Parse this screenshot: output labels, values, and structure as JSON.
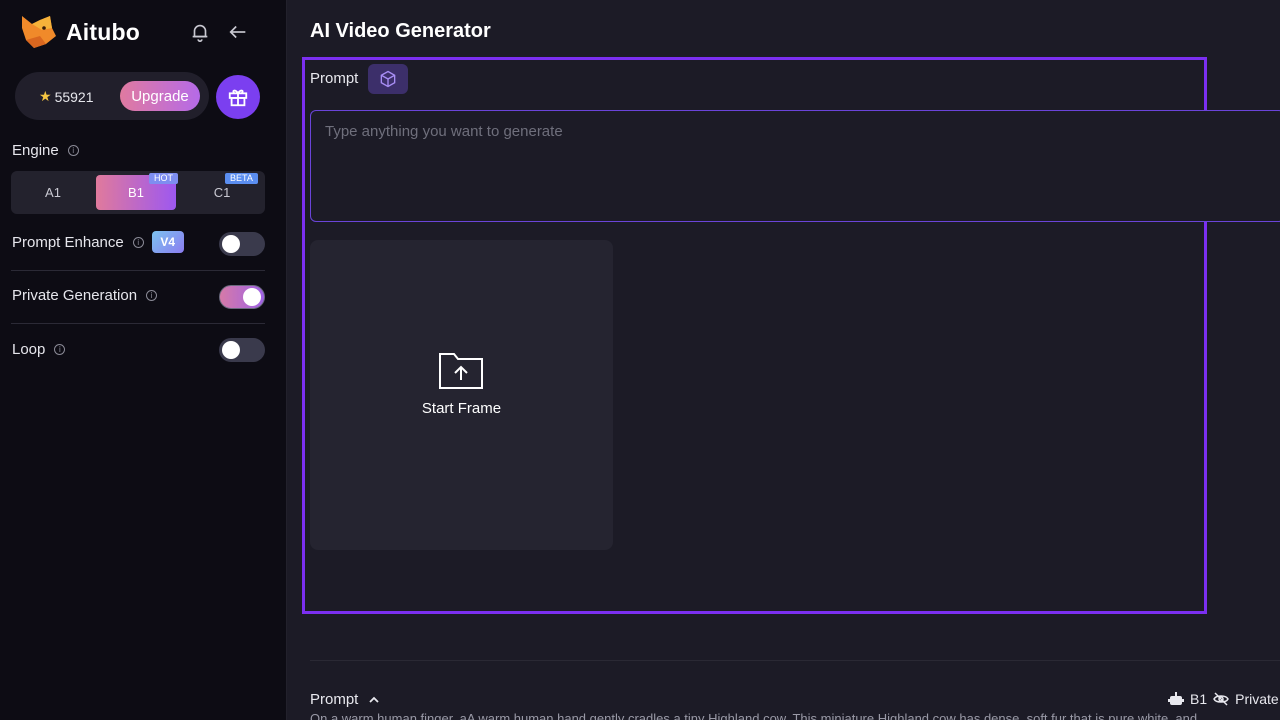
{
  "brand": {
    "name": "Aitubo"
  },
  "credits": {
    "amount": "55921",
    "upgrade_label": "Upgrade"
  },
  "engine": {
    "label": "Engine",
    "options": [
      {
        "label": "A1",
        "tag": ""
      },
      {
        "label": "B1",
        "tag": "HOT"
      },
      {
        "label": "C1",
        "tag": "BETA"
      }
    ],
    "selected": "B1"
  },
  "settings": {
    "prompt_enhance": {
      "label": "Prompt Enhance",
      "badge": "V4",
      "enabled": false
    },
    "private_generation": {
      "label": "Private Generation",
      "enabled": true
    },
    "loop": {
      "label": "Loop",
      "enabled": false
    }
  },
  "main": {
    "title": "AI Video Generator",
    "prompt_label": "Prompt",
    "prompt_placeholder": "Type anything you want to generate",
    "start_frame_label": "Start Frame"
  },
  "history": {
    "prompt_label": "Prompt",
    "prompt_text": "On a warm human finger, aA warm human hand gently cradles a tiny Highland cow. This miniature Highland cow has dense, soft fur that is pure white, and",
    "engine": "B1",
    "visibility": "Private"
  },
  "colors": {
    "accent": "#7b2ff0",
    "sidebar_bg": "#0d0c14",
    "main_bg": "#1c1b26"
  }
}
